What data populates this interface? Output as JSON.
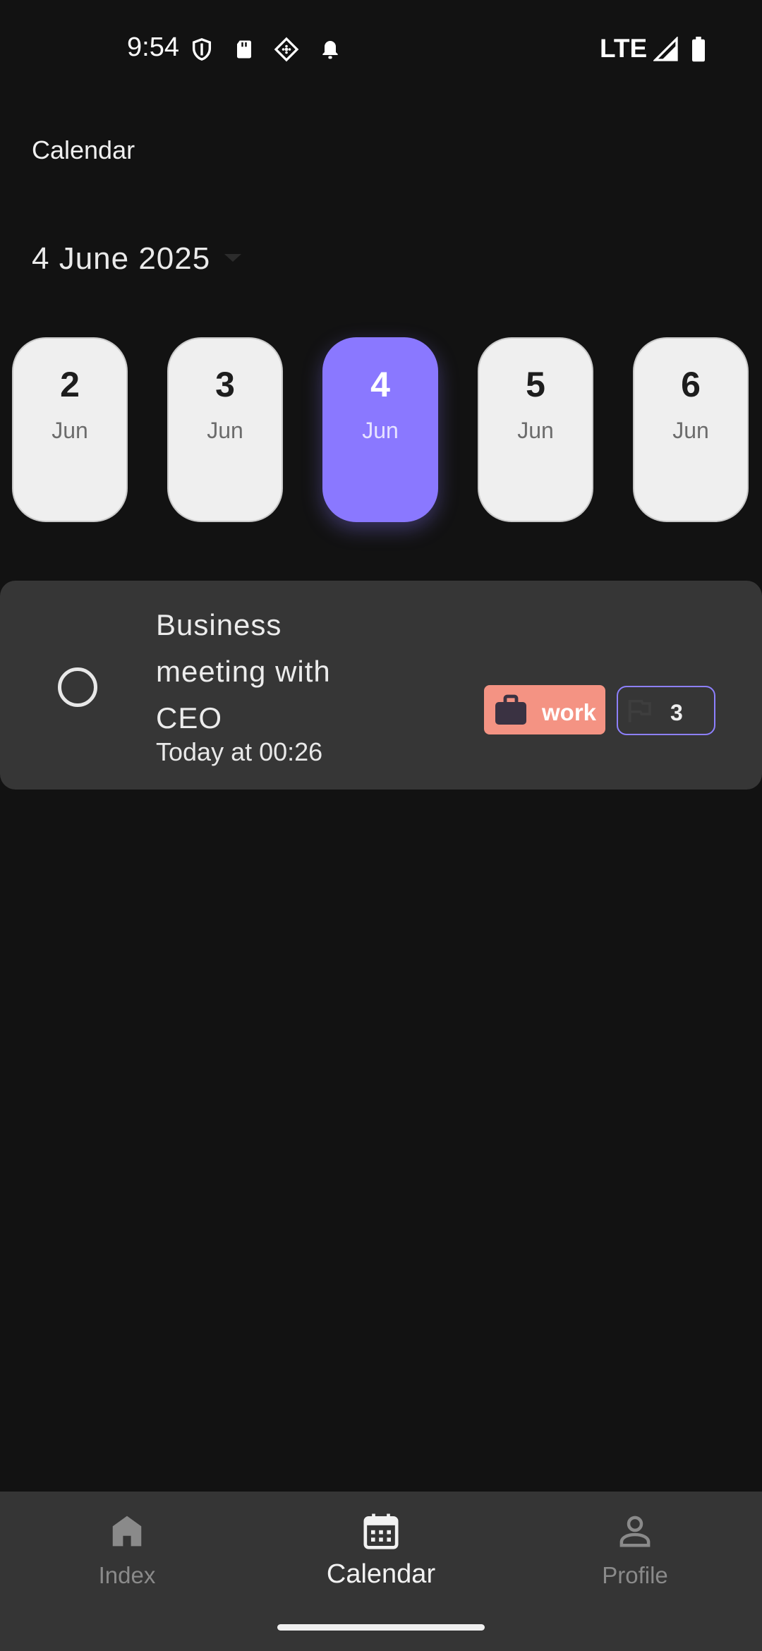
{
  "status_bar": {
    "time": "9:54",
    "network": "LTE"
  },
  "header": {
    "title": "Calendar",
    "selected_date": "4 June 2025"
  },
  "days": [
    {
      "num": "2",
      "month": "Jun"
    },
    {
      "num": "3",
      "month": "Jun"
    },
    {
      "num": "4",
      "month": "Jun",
      "selected": true
    },
    {
      "num": "5",
      "month": "Jun"
    },
    {
      "num": "6",
      "month": "Jun"
    }
  ],
  "task": {
    "title": "Business meeting with CEO",
    "time": "Today at 00:26",
    "category": {
      "label": "work",
      "icon": "briefcase-icon",
      "color": "#f49383"
    },
    "priority": {
      "label": "3",
      "icon": "flag-icon",
      "border_color": "#8d80ff"
    }
  },
  "nav": {
    "items": [
      {
        "label": "Index",
        "icon": "home-icon"
      },
      {
        "label": "Calendar",
        "icon": "calendar-icon",
        "active": true
      },
      {
        "label": "Profile",
        "icon": "person-icon"
      }
    ]
  },
  "colors": {
    "accent": "#8a78ff",
    "background": "#121212",
    "card": "#363636"
  }
}
